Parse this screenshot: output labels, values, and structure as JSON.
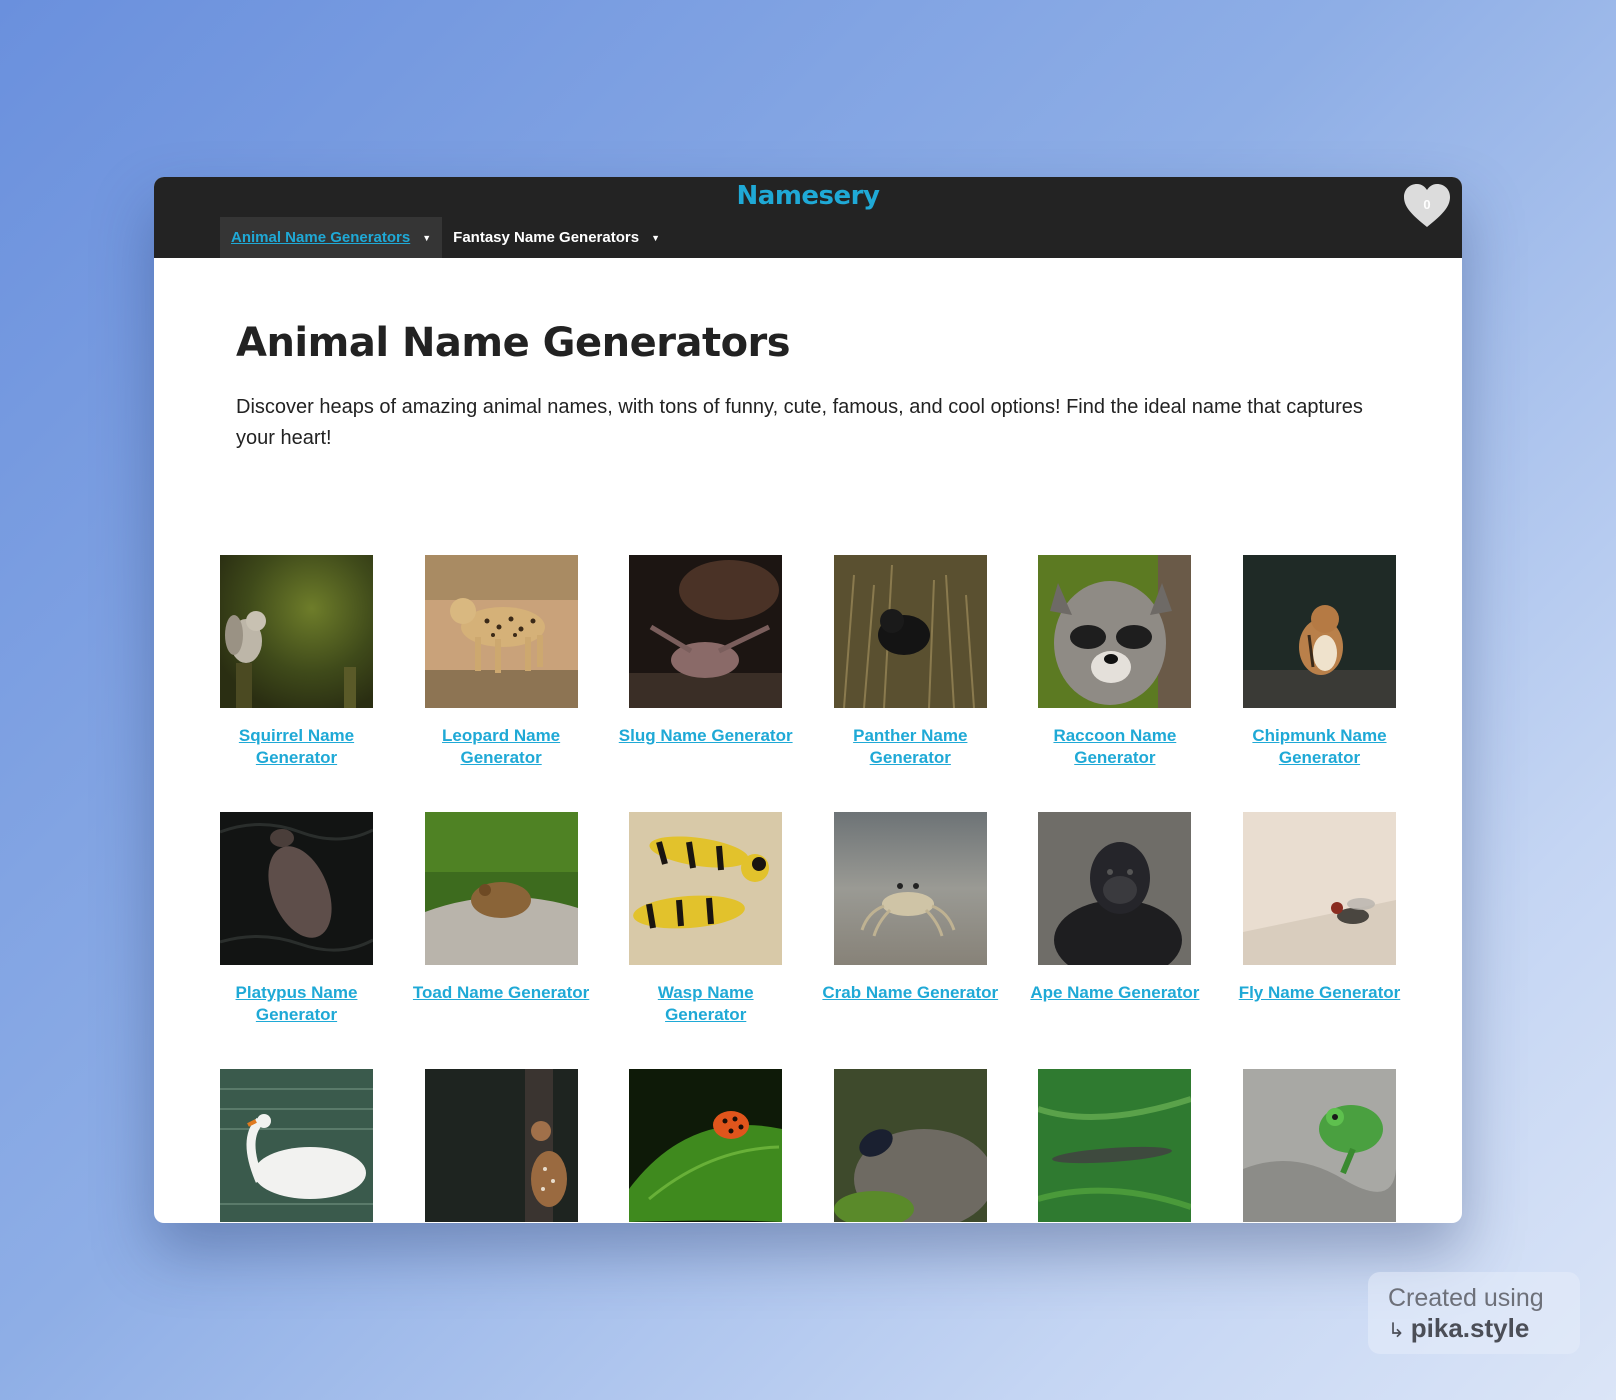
{
  "app": {
    "brand": "Namesery",
    "favorites_count": "0",
    "nav": [
      {
        "label": "Animal Name Generators",
        "active": true
      },
      {
        "label": "Fantasy Name Generators",
        "active": false
      }
    ]
  },
  "page": {
    "title": "Animal Name Generators",
    "intro": "Discover heaps of amazing animal names, with tons of funny, cute, famous, and cool options! Find the ideal name that captures your heart!"
  },
  "cards": [
    {
      "label": "Squirrel Name Generator",
      "icon": "squirrel-photo"
    },
    {
      "label": "Leopard Name Generator",
      "icon": "leopard-photo"
    },
    {
      "label": "Slug Name Generator",
      "icon": "slug-photo"
    },
    {
      "label": "Panther Name Generator",
      "icon": "panther-photo"
    },
    {
      "label": "Raccoon Name Generator",
      "icon": "raccoon-photo"
    },
    {
      "label": "Chipmunk Name Generator",
      "icon": "chipmunk-photo"
    },
    {
      "label": "Platypus Name Generator",
      "icon": "platypus-photo"
    },
    {
      "label": "Toad Name Generator",
      "icon": "toad-photo"
    },
    {
      "label": "Wasp Name Generator",
      "icon": "wasp-photo"
    },
    {
      "label": "Crab Name Generator",
      "icon": "crab-photo"
    },
    {
      "label": "Ape Name Generator",
      "icon": "ape-photo"
    },
    {
      "label": "Fly Name Generator",
      "icon": "fly-photo"
    },
    {
      "icon": "swan-photo"
    },
    {
      "icon": "deer-photo"
    },
    {
      "icon": "ladybug-photo"
    },
    {
      "icon": "beetle-photo"
    },
    {
      "icon": "crocodile-photo"
    },
    {
      "icon": "chameleon-photo"
    }
  ],
  "watermark": {
    "line1": "Created using",
    "line2": "pika.style"
  },
  "colors": {
    "accent": "#1fa9d6",
    "topbar": "#232323"
  }
}
